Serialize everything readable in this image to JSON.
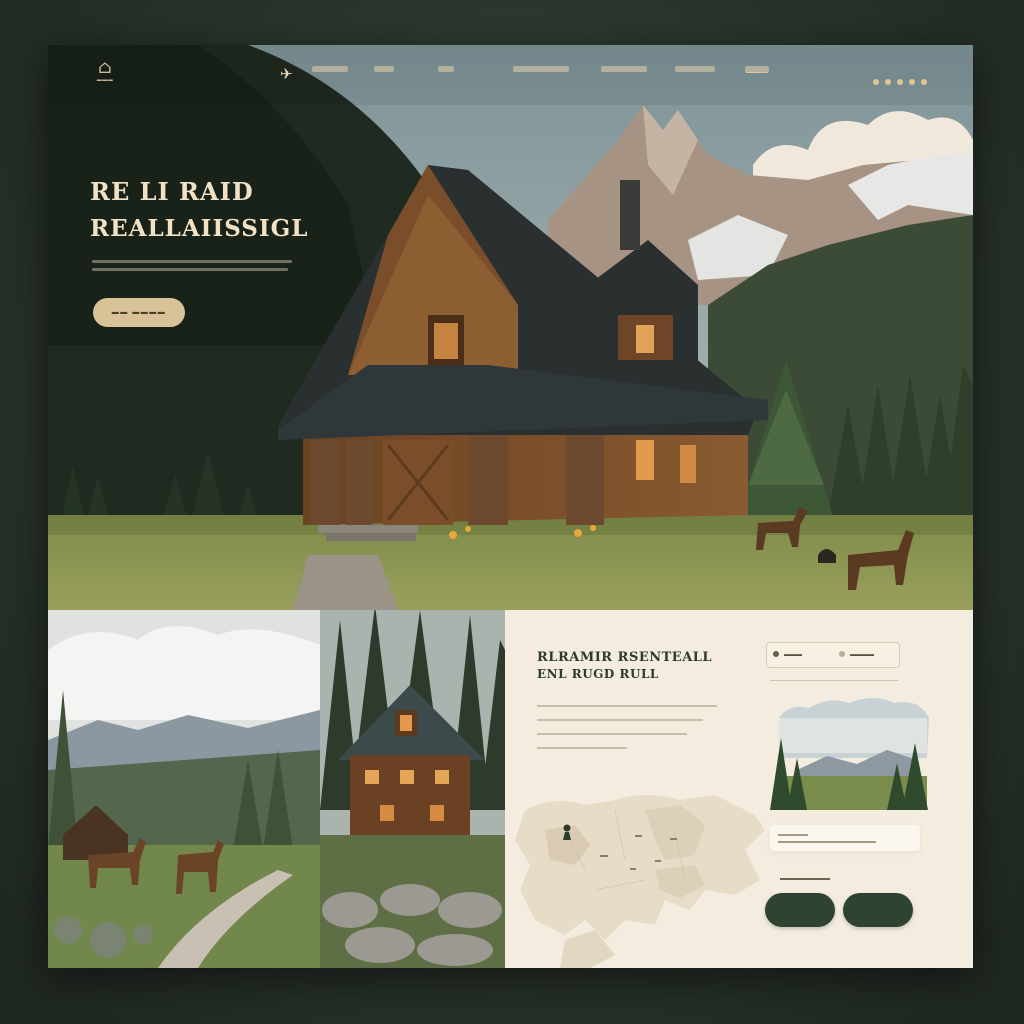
{
  "hero": {
    "title_line1": "RE LI RAID",
    "title_line2": "REALLAIISSIGL"
  },
  "panel": {
    "heading_line1": "RLRAMIR RSENTEALL",
    "heading_line2": "ENL RUGD RULL"
  },
  "icons": {
    "logo": "cabin-logo-icon",
    "nav_bird": "bird-icon",
    "menu": "dots-menu-icon",
    "map_pin": "hiker-pin-icon"
  },
  "colors": {
    "forest_dark": "#2f4333",
    "cream": "#f3ecdd",
    "tan_button": "#d9c198",
    "hero_text": "#f1e2c6"
  }
}
